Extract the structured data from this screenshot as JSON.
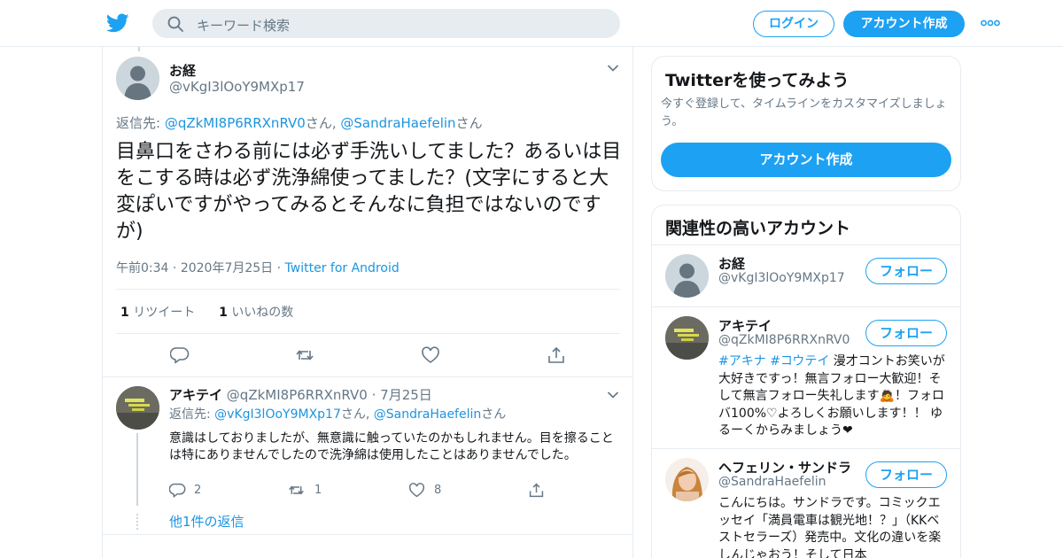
{
  "header": {
    "search_placeholder": "キーワード検索",
    "login_label": "ログイン",
    "signup_label": "アカウント作成",
    "brand_color": "#1da1f2"
  },
  "tweet": {
    "name": "お経",
    "handle": "@vKgI3lOoY9MXp17",
    "reply_prefix": "返信先: ",
    "reply_user1": "@qZkMI8P6RRXnRV0",
    "reply_san1": "さん, ",
    "reply_user2": "@SandraHaefelin",
    "reply_san2": "さん",
    "text": "目鼻口をさわる前には必ず手洗いしてました？あるいは目をこする時は必ず洗浄綿使ってました？(文字にすると大変ぽいですがやってみるとそんなに負担ではないのですが)",
    "time": "午前0:34",
    "date": "2020年7月25日",
    "dot": "·",
    "source": "Twitter for Android",
    "retweet_count": "1",
    "retweet_label": "リツイート",
    "like_count": "1",
    "like_label": "いいねの数"
  },
  "reply": {
    "name": "アキテイ",
    "handle": "@qZkMI8P6RRXnRV0",
    "dot": "·",
    "date": "7月25日",
    "reply_prefix": "返信先: ",
    "reply_user1": "@vKgI3lOoY9MXp17",
    "reply_san1": "さん, ",
    "reply_user2": "@SandraHaefelin",
    "reply_san2": "さん",
    "text": "意識はしておりましたが、無意識に触っていたのかもしれません。目を擦ることは特にありませんでしたので洗浄綿は使用したことはありませんでした。",
    "reply_count": "2",
    "retweet_count": "1",
    "like_count": "8",
    "more_replies": "他1件の返信"
  },
  "sidebar": {
    "try_title": "Twitterを使ってみよう",
    "try_desc": "今すぐ登録して、タイムラインをカスタマイズしましょう。",
    "try_button": "アカウント作成",
    "related_title": "関連性の高いアカウント",
    "follow_label": "フォロー",
    "accounts": [
      {
        "name": "お経",
        "handle": "@vKgI3lOoY9MXp17"
      },
      {
        "name": "アキテイ",
        "handle": "@qZkMI8P6RRXnRV0",
        "bio_tag1": "#アキナ",
        "bio_tag2": "#コウテイ",
        "bio_rest": " 漫才コントお笑いが大好きですっ！無言フォロー大歓迎！そして無言フォロー失礼します🙇！フォロバ100%♡よろしくお願いします！！ ゆるーくからみましょう❤"
      },
      {
        "name": "ヘフェリン・サンドラ",
        "handle": "@SandraHaefelin",
        "bio": "こんにちは。サンドラです。コミックエッセイ「満員電車は観光地！？」（KKベストセラーズ）発売中。文化の違いを楽しんじゃおう！そして日本"
      }
    ]
  }
}
